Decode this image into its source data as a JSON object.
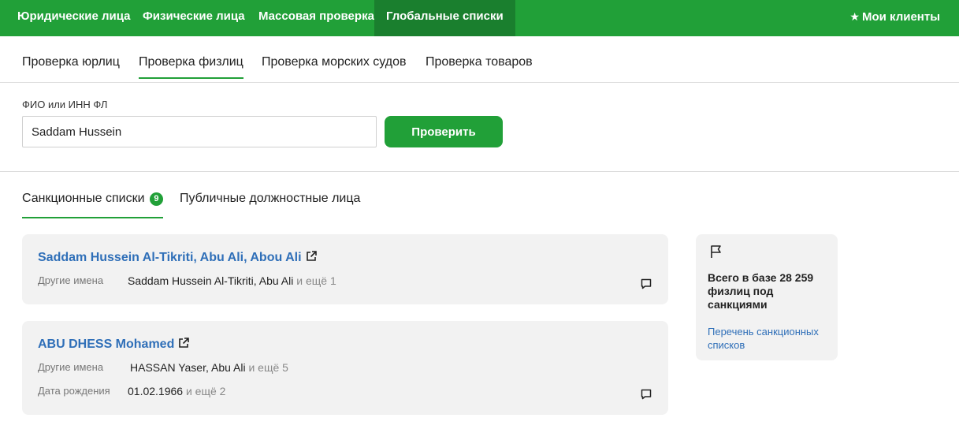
{
  "topnav": {
    "items": [
      {
        "label": "Юридические лица"
      },
      {
        "label": "Физические лица"
      },
      {
        "label": "Массовая проверка"
      },
      {
        "label": "Глобальные списки"
      }
    ],
    "my_clients": "Мои клиенты"
  },
  "subtabs": [
    {
      "label": "Проверка юрлиц"
    },
    {
      "label": "Проверка физлиц"
    },
    {
      "label": "Проверка морских судов"
    },
    {
      "label": "Проверка товаров"
    }
  ],
  "search": {
    "label": "ФИО или ИНН ФЛ",
    "value": "Saddam Hussein",
    "button": "Проверить"
  },
  "result_tabs": [
    {
      "label": "Санкционные списки",
      "count": "9"
    },
    {
      "label": "Публичные должностные лица"
    }
  ],
  "results": [
    {
      "name": "Saddam Hussein Al-Tikriti, Abu Ali, Abou Ali",
      "other_names_label": "Другие имена",
      "other_names": "Saddam Hussein Al-Tikriti, Abu Ali",
      "other_names_more": "и ещё 1"
    },
    {
      "name": "ABU DHESS Mohamed",
      "other_names_label": "Другие имена",
      "other_names": "HASSAN Yaser, Abu Ali",
      "other_names_more": "и ещё 5",
      "dob_label": "Дата рождения",
      "dob": "01.02.1966",
      "dob_more": "и ещё 2"
    }
  ],
  "sidebar": {
    "summary": "Всего в базе 28 259 физлиц под санкциями",
    "link": "Перечень санкционных списков"
  },
  "colors": {
    "brand_green": "#21a038",
    "active_nav": "#1a7f2e",
    "link_blue": "#2f6fb8",
    "card_bg": "#f2f2f2"
  }
}
